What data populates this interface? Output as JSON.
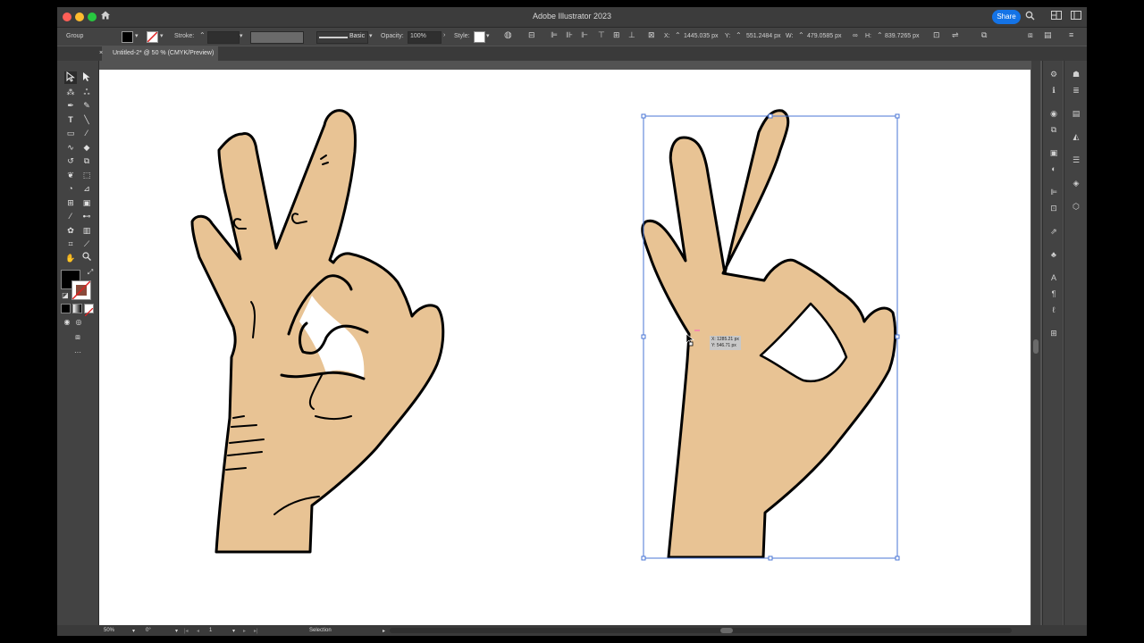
{
  "app": {
    "title": "Adobe Illustrator 2023",
    "share_label": "Share"
  },
  "control_bar": {
    "selection_type": "Group",
    "stroke_label": "Stroke:",
    "brush_label": "Basic",
    "opacity_label": "Opacity:",
    "opacity_value": "100%",
    "style_label": "Style:",
    "x_label": "X:",
    "x_value": "1445.035 px",
    "y_label": "Y:",
    "y_value": "551.2484 px",
    "w_label": "W:",
    "w_value": "479.0585 px",
    "h_label": "H:",
    "h_value": "839.7265 px"
  },
  "document_tab": {
    "label": "Untitled-2* @ 50 % (CMYK/Preview)",
    "close_glyph": "×"
  },
  "tooltip": {
    "x_text": "X: 1285.21 px",
    "y_text": "Y: 546.71 px"
  },
  "status_bar": {
    "zoom": "50%",
    "rotation": "0°",
    "artboard_number": "1",
    "tool_name": "Selection"
  },
  "colors": {
    "skin": "#e8c394",
    "outline": "#000000",
    "selection": "#4a76d6",
    "accent": "#1473e6"
  },
  "icons": {
    "home": "home-icon",
    "search": "search-icon",
    "arrange": "arrange-documents-icon",
    "selection_tool": "selection-arrow-icon",
    "direct_selection_tool": "direct-selection-icon",
    "type_tool": "type-icon",
    "hand_tool": "hand-icon",
    "zoom_tool": "zoom-icon"
  }
}
